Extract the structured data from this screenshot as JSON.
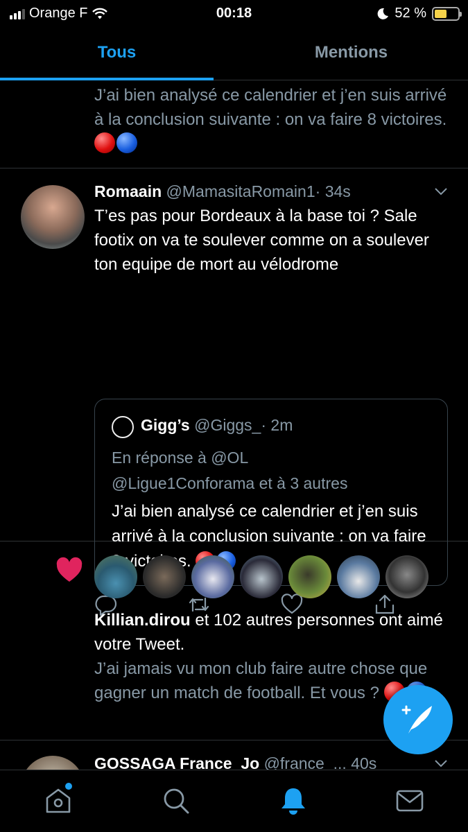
{
  "status_bar": {
    "carrier": "Orange F",
    "time": "00:18",
    "battery_pct": "52 %",
    "battery_level": 0.52
  },
  "tabs": {
    "all": "Tous",
    "mentions": "Mentions"
  },
  "top_item": {
    "text": "J’ai bien analysé ce calendrier et j’en suis arrivé à la conclusion suivante : on va faire 8 victoires."
  },
  "tweet": {
    "name": "Romaain",
    "handle": "@MamasitaRomain1",
    "sep": "·",
    "time": "34s",
    "body": "T’es pas pour Bordeaux à la base toi ? Sale footix on va te soulever comme on a soulever ton equipe de mort au vélodrome",
    "quote": {
      "name": "Gigg’s",
      "handle": "@Giggs_",
      "sep": "·",
      "time": "2m",
      "reply_line1": "En réponse à @OL",
      "reply_line2": "@Ligue1Conforama et à 3 autres",
      "text": "J’ai bien analysé ce calendrier et j’en suis arrivé à la conclusion suivante : on va faire 8 victoires."
    }
  },
  "like_notification": {
    "user": "Killian.dirou",
    "rest": " et 102 autres personnes ont aimé votre Tweet.",
    "quote_text": "J’ai jamais vu mon club faire autre chose que gagner un match de football. Et vous ?"
  },
  "bottom_item": {
    "name": "GOSSAGA France_Jo",
    "handle": "@france_...",
    "time": "40s"
  },
  "icons": {
    "home": "home-icon",
    "search": "search-icon",
    "notifications": "bell-icon",
    "messages": "envelope-icon",
    "compose": "compose-tweet-icon"
  },
  "colors": {
    "accent": "#1da1f2",
    "muted": "#8899a6",
    "like": "#e0245e"
  }
}
